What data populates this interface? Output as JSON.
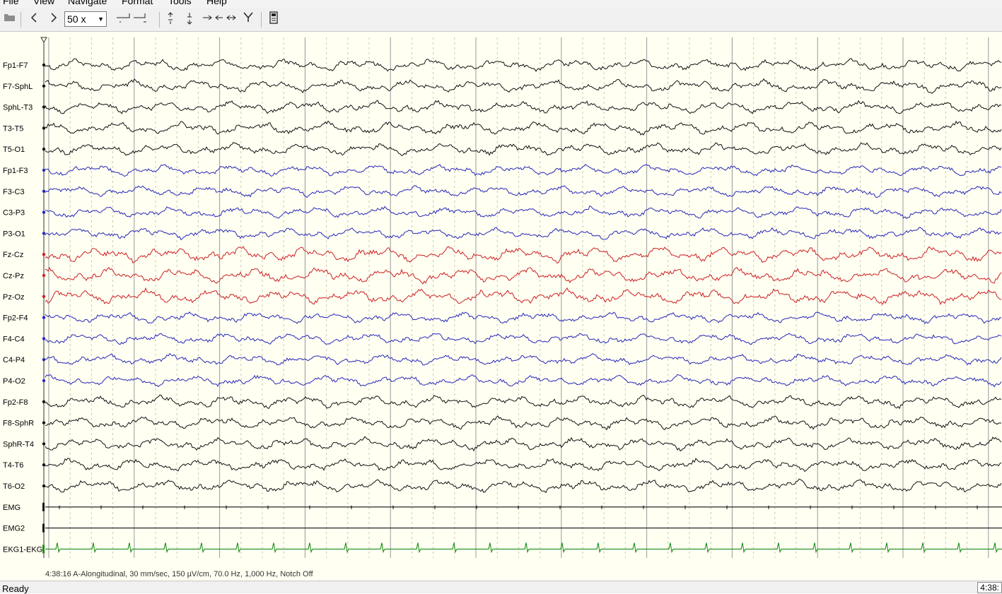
{
  "menu": [
    "File",
    "View",
    "Navigate",
    "Format",
    "Tools",
    "Help"
  ],
  "toolbar": {
    "zoom_value": "50 x",
    "icons": [
      "open-icon",
      "prev-page-icon",
      "next-page-icon",
      "zoom-select",
      "timebase-icon",
      "amplitude-up-icon",
      "amplitude-down-icon",
      "horizontal-scale-icon",
      "filter-icon",
      "print-icon"
    ]
  },
  "colors": {
    "background": "#fffff2",
    "black_trace": "#111111",
    "blue_trace": "#2727b8",
    "red_trace": "#cc2020",
    "green_trace": "#1a8f1a"
  },
  "channels": [
    {
      "label": "Fp1-F7",
      "color": "black"
    },
    {
      "label": "F7-SphL",
      "color": "black"
    },
    {
      "label": "SphL-T3",
      "color": "black"
    },
    {
      "label": "T3-T5",
      "color": "black"
    },
    {
      "label": "T5-O1",
      "color": "black"
    },
    {
      "label": "Fp1-F3",
      "color": "blue"
    },
    {
      "label": "F3-C3",
      "color": "blue"
    },
    {
      "label": "C3-P3",
      "color": "blue"
    },
    {
      "label": "P3-O1",
      "color": "blue"
    },
    {
      "label": "Fz-Cz",
      "color": "red"
    },
    {
      "label": "Cz-Pz",
      "color": "red"
    },
    {
      "label": "Pz-Oz",
      "color": "red"
    },
    {
      "label": "Fp2-F4",
      "color": "blue"
    },
    {
      "label": "F4-C4",
      "color": "blue"
    },
    {
      "label": "C4-P4",
      "color": "blue"
    },
    {
      "label": "P4-O2",
      "color": "blue"
    },
    {
      "label": "Fp2-F8",
      "color": "black"
    },
    {
      "label": "F8-SphR",
      "color": "black"
    },
    {
      "label": "SphR-T4",
      "color": "black"
    },
    {
      "label": "T4-T6",
      "color": "black"
    },
    {
      "label": "T6-O2",
      "color": "black"
    },
    {
      "label": "EMG",
      "color": "black",
      "type": "emg"
    },
    {
      "label": "EMG2",
      "color": "black",
      "type": "flat"
    },
    {
      "label": "EKG1-EKG",
      "color": "green",
      "type": "ekg"
    }
  ],
  "footer": "4:38:16 A-Alongitudinal, 30 mm/sec, 150 µV/cm, 70.0 Hz, 1,000 Hz, Notch Off",
  "status": {
    "ready": "Ready",
    "time": "4:38:"
  }
}
